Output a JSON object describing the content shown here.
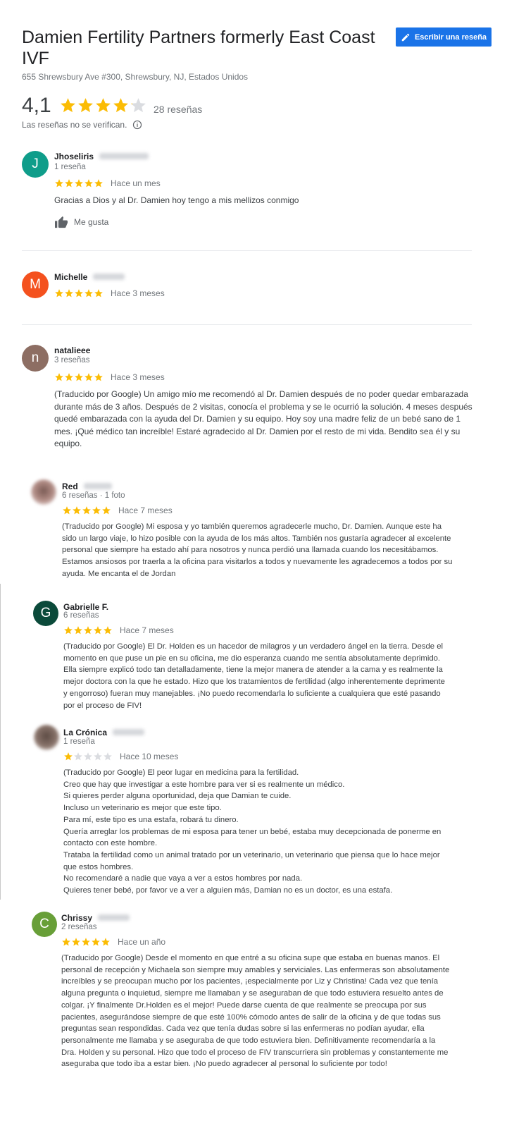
{
  "header": {
    "title": "Damien Fertility Partners formerly East Coast IVF",
    "address": "655 Shrewsbury Ave #300, Shrewsbury, NJ, Estados Unidos",
    "write_review_label": "Escribir una reseña",
    "rating": "4,1",
    "rating_value": 4.1,
    "review_count": "28 reseñas",
    "not_verified": "Las reseñas no se verifican."
  },
  "colors": {
    "accent": "#1a73e8",
    "star": "#fbbc04",
    "star_off": "#dadce0"
  },
  "reviews": [
    {
      "initial": "J",
      "avatar_color": "#0f9d8a",
      "name": "Jhoseliris",
      "meta": "1 reseña",
      "stars": 5,
      "date": "Hace un mes",
      "text": "Gracias a Dios y  al Dr. Damien hoy tengo a mis mellizos conmigo",
      "like_label": "Me gusta"
    },
    {
      "initial": "M",
      "avatar_color": "#f4511e",
      "name": "Michelle",
      "meta": "",
      "stars": 5,
      "date": "Hace 3 meses",
      "text": ""
    },
    {
      "initial": "n",
      "avatar_color": "#8d6e63",
      "name": "natalieee",
      "meta": "3 reseñas",
      "stars": 5,
      "date": "Hace 3 meses",
      "text": "(Traducido por Google) Un amigo mío me recomendó al Dr. Damien después de no poder quedar embarazada durante más de 3 años. Después de 2 visitas, conocía el problema y se le ocurrió la solución. 4 meses después quedé embarazada con la ayuda del Dr. Damien y su equipo. Hoy soy una madre feliz de un bebé sano de 1 mes. ¡Qué médico tan increíble! Estaré agradecido al Dr. Damien por el resto de mi vida. Bendito sea él y su equipo."
    },
    {
      "initial": "",
      "avatar_color": "",
      "name": "Red",
      "meta": "6 reseñas · 1 foto",
      "stars": 5,
      "date": "Hace 7 meses",
      "text": "(Traducido por Google) Mi esposa y yo también queremos agradecerle mucho, Dr. Damien. Aunque este ha sido un largo viaje, lo hizo posible con la ayuda de los más altos. También nos gustaría agradecer al excelente personal que siempre ha estado ahí para nosotros y nunca perdió una llamada cuando los necesitábamos. Estamos ansiosos por traerla a la oficina para visitarlos a todos y nuevamente les agradecemos a todos por su ayuda. Me encanta el de Jordan"
    },
    {
      "initial": "G",
      "avatar_color": "#0b4a3a",
      "name": "Gabrielle F.",
      "meta": "6 reseñas",
      "stars": 5,
      "date": "Hace 7 meses",
      "text": "(Traducido por Google) El Dr. Holden es un hacedor de milagros y un verdadero ángel en la tierra. Desde el momento en que puse un pie en su oficina, me dio esperanza cuando me sentía absolutamente deprimido. Ella siempre explicó todo tan detalladamente, tiene la mejor manera de atender a la cama y es realmente la mejor doctora con la que he estado. Hizo que los tratamientos de fertilidad (algo inherentemente deprimente y engorroso) fueran muy manejables. ¡No puedo recomendarla lo suficiente a cualquiera que esté pasando por el proceso de FIV!"
    },
    {
      "initial": "",
      "avatar_color": "",
      "name": "La Crónica",
      "meta": "1 reseña",
      "stars": 1,
      "date": "Hace 10 meses",
      "lines": [
        "(Traducido por Google) El peor lugar en medicina para la fertilidad.",
        "Creo que hay que investigar a este hombre para ver si es realmente un médico.",
        "Si quieres perder alguna oportunidad, deja que Damian te cuide.",
        "Incluso un veterinario es mejor que este tipo.",
        "Para mí, este tipo es una estafa, robará tu dinero.",
        "Quería arreglar los problemas de mi esposa para tener un bebé, estaba muy decepcionada de ponerme en contacto con este hombre.",
        "Trataba la fertilidad como un animal tratado por un veterinario, un veterinario que piensa que lo hace mejor que estos hombres.",
        "No recomendaré a nadie que vaya a ver a estos hombres por nada.",
        "Quieres tener bebé, por favor ve a ver a alguien más, Damian no es un doctor, es una estafa."
      ]
    },
    {
      "initial": "C",
      "avatar_color": "#689f38",
      "name": "Chrissy",
      "meta": "2 reseñas",
      "stars": 5,
      "date": "Hace un año",
      "text": "(Traducido por Google) Desde el momento en que entré a su oficina supe que estaba en buenas manos. El personal de recepción y Michaela son siempre muy amables y serviciales. Las enfermeras son absolutamente increíbles y se preocupan mucho por los pacientes, ¡especialmente por Liz y Christina! Cada vez que tenía alguna pregunta o inquietud, siempre me llamaban y se aseguraban de que todo estuviera resuelto antes de colgar. ¡Y finalmente Dr.Holden es el mejor! Puede darse cuenta de que realmente se preocupa por sus pacientes, asegurándose siempre de que esté 100% cómodo antes de salir de la oficina y de que todas sus preguntas sean respondidas. Cada vez que tenía dudas sobre si las enfermeras no podían ayudar, ella personalmente me llamaba y se aseguraba de que todo estuviera bien. Definitivamente recomendaría a la Dra. Holden y su personal. Hizo que todo el proceso de FIV transcurriera sin problemas y constantemente me aseguraba que todo iba a estar bien. ¡No puedo agradecer al personal lo suficiente por todo!"
    }
  ]
}
